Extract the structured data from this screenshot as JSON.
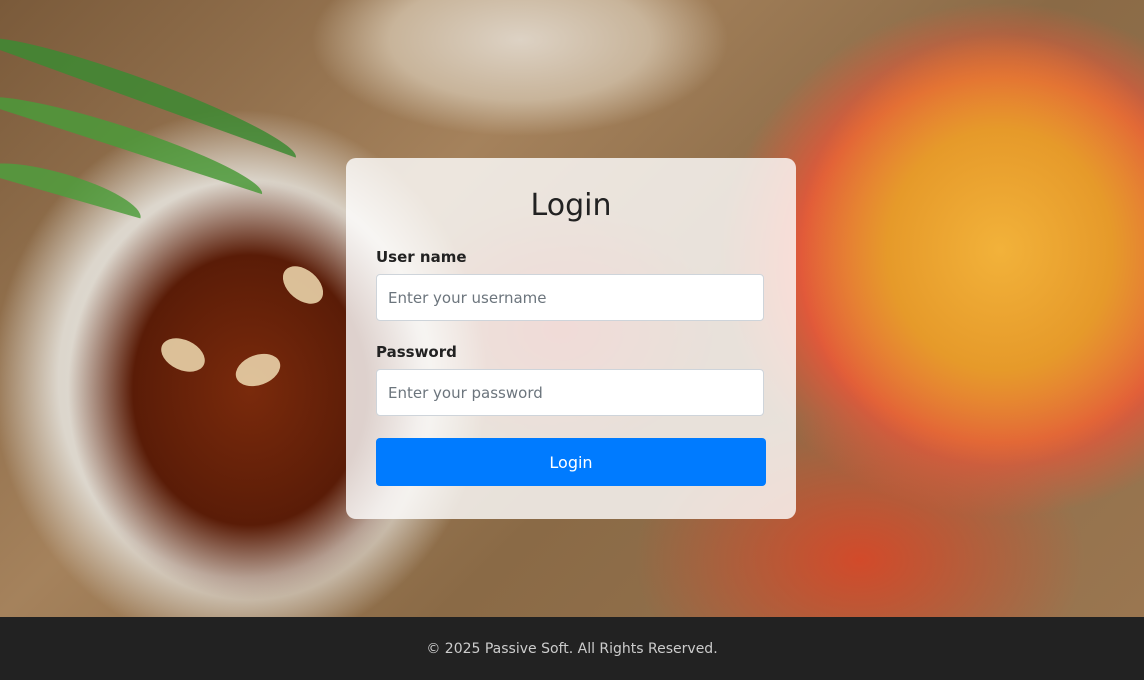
{
  "login": {
    "title": "Login",
    "username": {
      "label": "User name",
      "placeholder": "Enter your username",
      "value": ""
    },
    "password": {
      "label": "Password",
      "placeholder": "Enter your password",
      "value": ""
    },
    "submit_label": "Login"
  },
  "footer": {
    "copyright": "© 2025 Passive Soft. All Rights Reserved."
  },
  "colors": {
    "primary_button": "#007bff",
    "footer_bg": "#222222"
  }
}
